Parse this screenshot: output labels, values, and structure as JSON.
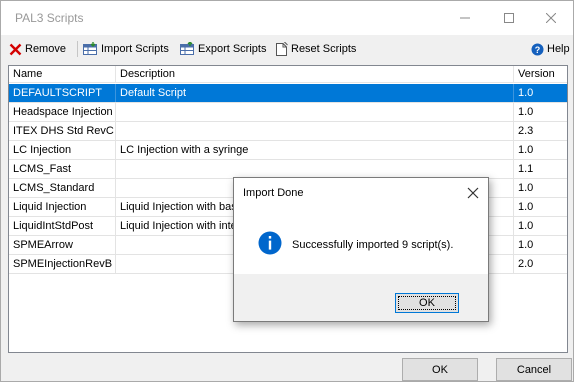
{
  "window": {
    "title": "PAL3 Scripts"
  },
  "toolbar": {
    "remove_label": "Remove",
    "import_label": "Import Scripts",
    "export_label": "Export Scripts",
    "reset_label": "Reset Scripts",
    "help_label": "Help"
  },
  "table": {
    "columns": [
      "Name",
      "Description",
      "Version"
    ],
    "rows": [
      {
        "name": "DEFAULTSCRIPT",
        "description": "Default Script",
        "version": "1.0"
      },
      {
        "name": "Headspace Injection",
        "description": "",
        "version": "1.0"
      },
      {
        "name": "ITEX DHS Std RevC",
        "description": "",
        "version": "2.3"
      },
      {
        "name": "LC Injection",
        "description": "LC Injection with a syringe",
        "version": "1.0"
      },
      {
        "name": "LCMS_Fast",
        "description": "",
        "version": "1.1"
      },
      {
        "name": "LCMS_Standard",
        "description": "",
        "version": "1.0"
      },
      {
        "name": "Liquid Injection",
        "description": "Liquid Injection with basic",
        "version": "1.0"
      },
      {
        "name": "LiquidIntStdPost",
        "description": "Liquid Injection with interna",
        "version": "1.0"
      },
      {
        "name": "SPMEArrow",
        "description": "",
        "version": "1.0"
      },
      {
        "name": "SPMEInjectionRevB",
        "description": "",
        "version": "2.0"
      }
    ]
  },
  "footer": {
    "ok_label": "OK",
    "cancel_label": "Cancel"
  },
  "dialog": {
    "title": "Import Done",
    "message": "Successfully imported 9 script(s).",
    "ok_label": "OK"
  },
  "colors": {
    "selection": "#0078d7",
    "remove_icon": "#d40000",
    "info_icon": "#0066cc",
    "help_icon": "#1560bd"
  }
}
